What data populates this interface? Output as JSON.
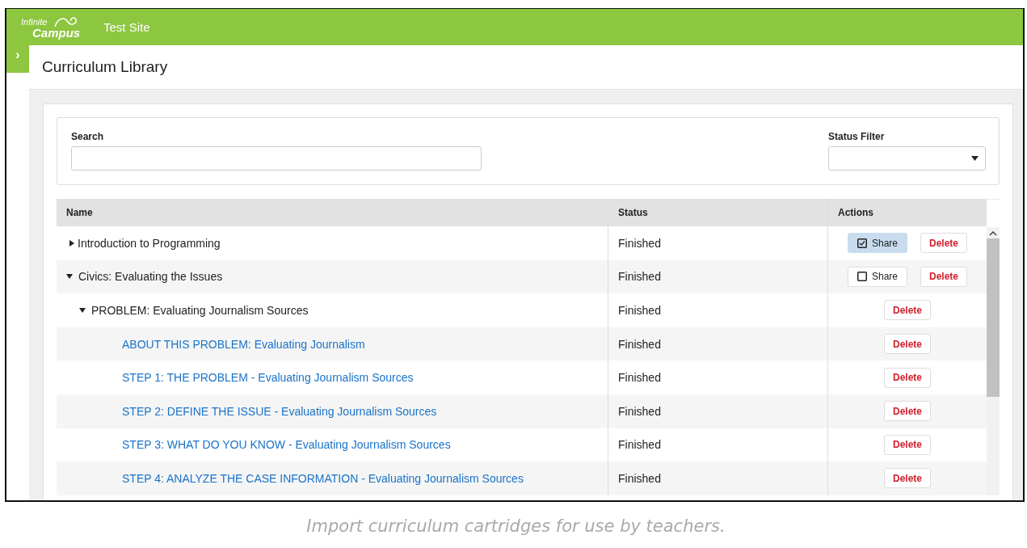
{
  "header": {
    "logo_line_1": "Infinite",
    "logo_line_2": "Campus",
    "site": "Test Site"
  },
  "sidebar_toggle": "›",
  "page_title": "Curriculum Library",
  "filters": {
    "search_label": "Search",
    "status_label": "Status Filter"
  },
  "table": {
    "columns": [
      "Name",
      "Status",
      "Actions"
    ],
    "rows": [
      {
        "name": "Introduction to Programming",
        "status": "Finished",
        "expanded": false,
        "share": {
          "label": "Share",
          "checked": true
        },
        "delete": "Delete"
      },
      {
        "name": "Civics: Evaluating the Issues",
        "status": "Finished",
        "expanded": true,
        "share": {
          "label": "Share",
          "checked": false
        },
        "delete": "Delete",
        "children": [
          {
            "name": "PROBLEM: Evaluating Journalism Sources",
            "status": "Finished",
            "expanded": true,
            "delete": "Delete",
            "children": [
              {
                "name": "ABOUT THIS PROBLEM: Evaluating Journalism",
                "status": "Finished",
                "delete": "Delete"
              },
              {
                "name": "STEP 1: THE PROBLEM - Evaluating Journalism Sources",
                "status": "Finished",
                "delete": "Delete"
              },
              {
                "name": "STEP 2: DEFINE THE ISSUE - Evaluating Journalism Sources",
                "status": "Finished",
                "delete": "Delete"
              },
              {
                "name": "STEP 3: WHAT DO YOU KNOW - Evaluating Journalism Sources",
                "status": "Finished",
                "delete": "Delete"
              },
              {
                "name": "STEP 4: ANALYZE THE CASE INFORMATION - Evaluating Journalism Sources",
                "status": "Finished",
                "delete": "Delete"
              }
            ]
          }
        ]
      }
    ]
  },
  "caption": "Import curriculum cartridges for use by teachers."
}
